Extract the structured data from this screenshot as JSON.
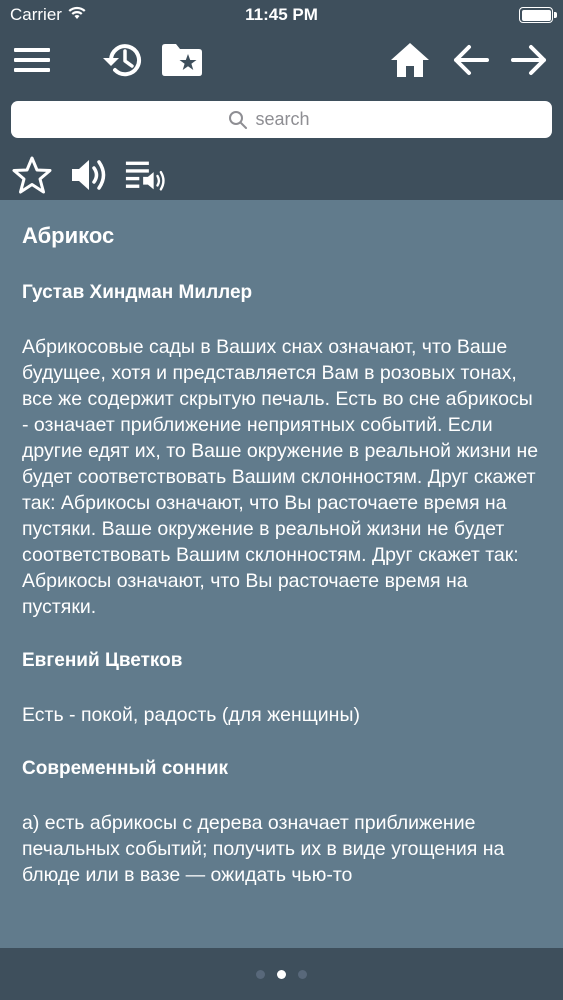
{
  "status": {
    "carrier": "Carrier",
    "time": "11:45 PM"
  },
  "search": {
    "placeholder": "search"
  },
  "article": {
    "title": "Абрикос",
    "sections": [
      {
        "heading": "Густав Хиндман Миллер",
        "text": "Абрикосовые сады в Ваших снах означают, что Ваше будущее, хотя и представляется Вам в розовых тонах, все же содержит скрытую печаль. Есть во сне абрикосы - означает приближение неприятных событий. Если другие едят их, то Ваше окружение в реальной жизни не будет соответствовать Вашим склонностям. Друг скажет так: Абрикосы означают, что Вы расточаете время на пустяки. Ваше окружение в реальной жизни не будет соответствовать Вашим склонностям. Друг скажет так: Абрикосы означают, что Вы расточаете время на пустяки."
      },
      {
        "heading": "Евгений Цветков",
        "text": "Есть - покой, радость (для женщины)"
      },
      {
        "heading": "Современный сонник",
        "text": "а) есть абрикосы с дерева означает приближение печальных событий; получить их в виде угощения на блюде или в вазе — ожидать чью-то"
      }
    ]
  },
  "pager": {
    "count": 3,
    "active": 1
  }
}
